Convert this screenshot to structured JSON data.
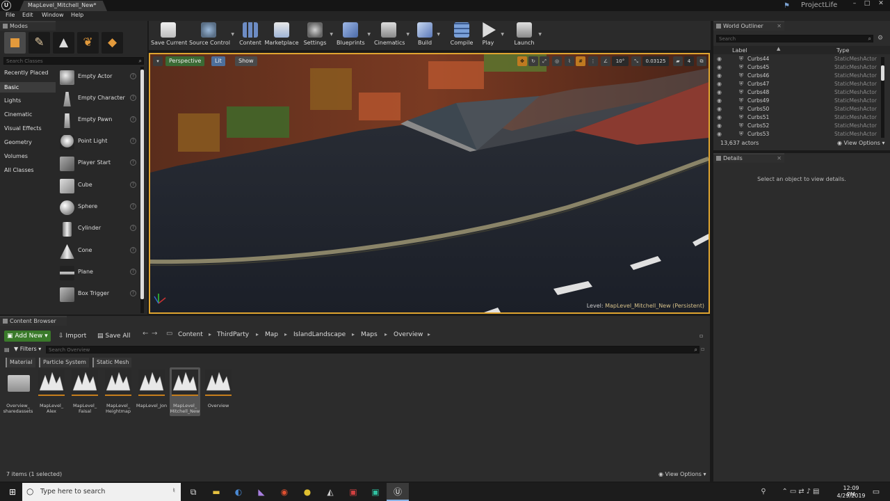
{
  "window": {
    "tab_title": "MapLevel_Mitchell_New*",
    "project": "ProjectLife",
    "logo": "U"
  },
  "menu": [
    "File",
    "Edit",
    "Window",
    "Help"
  ],
  "modes": {
    "title": "Modes",
    "search_placeholder": "Search Classes",
    "categories": [
      "Recently Placed",
      "Basic",
      "Lights",
      "Cinematic",
      "Visual Effects",
      "Geometry",
      "Volumes",
      "All Classes"
    ],
    "selected_category": "Basic",
    "classes": [
      "Empty Actor",
      "Empty Character",
      "Empty Pawn",
      "Point Light",
      "Player Start",
      "Cube",
      "Sphere",
      "Cylinder",
      "Cone",
      "Plane",
      "Box Trigger"
    ],
    "help_glyph": "?"
  },
  "toolbar": [
    {
      "label": "Save Current",
      "icon": "save-icon"
    },
    {
      "label": "Source Control",
      "icon": "source-control-icon"
    },
    {
      "label": "Content",
      "icon": "content-icon"
    },
    {
      "label": "Marketplace",
      "icon": "marketplace-icon"
    },
    {
      "label": "Settings",
      "icon": "settings-icon"
    },
    {
      "label": "Blueprints",
      "icon": "blueprints-icon"
    },
    {
      "label": "Cinematics",
      "icon": "cinematics-icon"
    },
    {
      "label": "Build",
      "icon": "build-icon"
    },
    {
      "label": "Compile",
      "icon": "compile-icon"
    },
    {
      "label": "Play",
      "icon": "play-icon"
    },
    {
      "label": "Launch",
      "icon": "launch-icon"
    }
  ],
  "viewport": {
    "view_mode": "Perspective",
    "lighting": "Lit",
    "show": "Show",
    "fov": "10°",
    "scale_snap": "0.03125",
    "speed": "4",
    "level_prefix": "Level:",
    "level_name": "MapLevel_Mitchell_New (Persistent)"
  },
  "outliner": {
    "title": "World Outliner",
    "search_placeholder": "Search",
    "col_label": "Label",
    "col_type": "Type",
    "rows": [
      {
        "label": "Curbs44",
        "type": "StaticMeshActor"
      },
      {
        "label": "Curbs45",
        "type": "StaticMeshActor"
      },
      {
        "label": "Curbs46",
        "type": "StaticMeshActor"
      },
      {
        "label": "Curbs47",
        "type": "StaticMeshActor"
      },
      {
        "label": "Curbs48",
        "type": "StaticMeshActor"
      },
      {
        "label": "Curbs49",
        "type": "StaticMeshActor"
      },
      {
        "label": "Curbs50",
        "type": "StaticMeshActor"
      },
      {
        "label": "Curbs51",
        "type": "StaticMeshActor"
      },
      {
        "label": "Curbs52",
        "type": "StaticMeshActor"
      },
      {
        "label": "Curbs53",
        "type": "StaticMeshActor"
      }
    ],
    "actor_count": "13,637 actors",
    "view_options": "View Options"
  },
  "details": {
    "title": "Details",
    "empty_text": "Select an object to view details."
  },
  "content_browser": {
    "title": "Content Browser",
    "add_new": "Add New",
    "import": "Import",
    "save_all": "Save All",
    "breadcrumb": [
      "Content",
      "ThirdParty",
      "Map",
      "IslandLandscape",
      "Maps",
      "Overview"
    ],
    "filters": "Filters",
    "search_placeholder": "Search Overview",
    "filter_chips": [
      "Material",
      "Particle System",
      "Static Mesh"
    ],
    "assets": [
      {
        "label": "Overview_\nsharedassets",
        "kind": "folder"
      },
      {
        "label": "MapLevel_\nAlex",
        "kind": "map"
      },
      {
        "label": "MapLevel_\nFaisal",
        "kind": "map"
      },
      {
        "label": "MapLevel_\nHeightmap",
        "kind": "map"
      },
      {
        "label": "MapLevel_Jon",
        "kind": "map"
      },
      {
        "label": "MapLevel_\nMitchell_New",
        "kind": "map"
      },
      {
        "label": "Overview",
        "kind": "map"
      }
    ],
    "selected_asset": "MapLevel_\nMitchell_New",
    "status": "7 items (1 selected)",
    "view_options": "View Options"
  },
  "taskbar": {
    "search_placeholder": "Type here to search",
    "time": "12:09 PM",
    "date": "4/29/2019"
  },
  "colors": {
    "accent_orange": "#e0a530",
    "add_new_green": "#3a7a2a",
    "asset_underline": "#c77f1c"
  }
}
